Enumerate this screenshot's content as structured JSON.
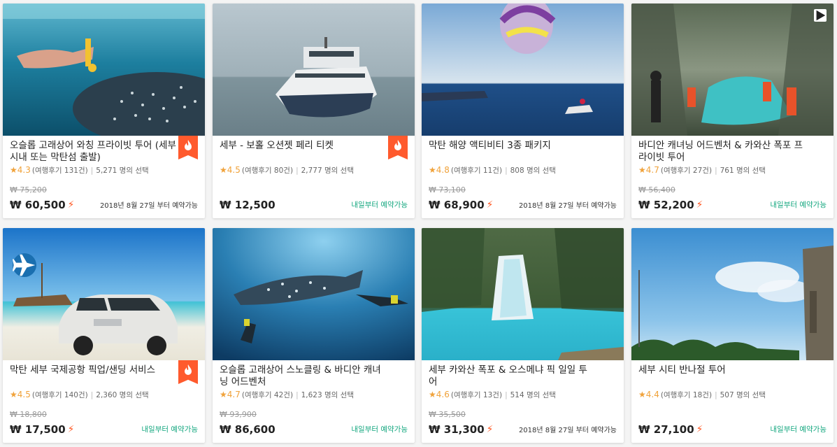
{
  "currency": "₩",
  "cards": [
    {
      "title": "오슬롭 고래상어 와칭 프라이빗 투어 (세부 시내 또는 막탄섬 출발)",
      "rating": "4.3",
      "reviews": "(여행후기 131건)",
      "selected": "5,271 명의 선택",
      "original_price": "₩ 75,200",
      "price": "₩ 60,500",
      "booking": "2018년 8월 27일 부터 예약가능",
      "badge": "hot-icon"
    },
    {
      "title": "세부 - 보홀 오션젯 페리 티켓",
      "rating": "4.5",
      "reviews": "(여행후기 80건)",
      "selected": "2,777 명의 선택",
      "original_price": "",
      "price": "₩ 12,500",
      "booking": "내일부터 예약가능",
      "badge": "hot-icon"
    },
    {
      "title": "막탄 해양 액티비티 3종 패키지",
      "rating": "4.8",
      "reviews": "(여행후기 11건)",
      "selected": "808 명의 선택",
      "original_price": "₩ 73,100",
      "price": "₩ 68,900",
      "booking": "2018년 8월 27일 부터 예약가능"
    },
    {
      "title": "바디안 캐녀닝 어드벤처 & 카와산 폭포 프라이빗 투어",
      "rating": "4.7",
      "reviews": "(여행후기 27건)",
      "selected": "761 명의 선택",
      "original_price": "₩ 56,400",
      "price": "₩ 52,200",
      "booking": "내일부터 예약가능",
      "badge": "play-icon"
    },
    {
      "title": "막탄 세부 국제공항 픽업/샌딩 서비스",
      "rating": "4.5",
      "reviews": "(여행후기 140건)",
      "selected": "2,360 명의 선택",
      "original_price": "₩ 18,800",
      "price": "₩ 17,500",
      "booking": "내일부터 예약가능",
      "badge": "hot-icon"
    },
    {
      "title": "오슬롭 고래상어 스노클링 & 바디안 캐녀닝 어드벤처",
      "rating": "4.7",
      "reviews": "(여행후기 42건)",
      "selected": "1,623 명의 선택",
      "original_price": "₩ 93,900",
      "price": "₩ 86,600",
      "booking": "내일부터 예약가능"
    },
    {
      "title": "세부 카와산 폭포 & 오스메냐 픽 일일 투어",
      "rating": "4.6",
      "reviews": "(여행후기 13건)",
      "selected": "514 명의 선택",
      "original_price": "₩ 35,500",
      "price": "₩ 31,300",
      "booking": "2018년 8월 27일 부터 예약가능"
    },
    {
      "title": "세부 시티 반나절 투어",
      "rating": "4.4",
      "reviews": "(여행후기 18건)",
      "selected": "507 명의 선택",
      "original_price": "",
      "price": "₩ 27,100",
      "booking": "내일부터 예약가능"
    }
  ],
  "colors": {
    "accent": "#ff5722",
    "star": "#f0a23a",
    "available": "#14a77f"
  }
}
